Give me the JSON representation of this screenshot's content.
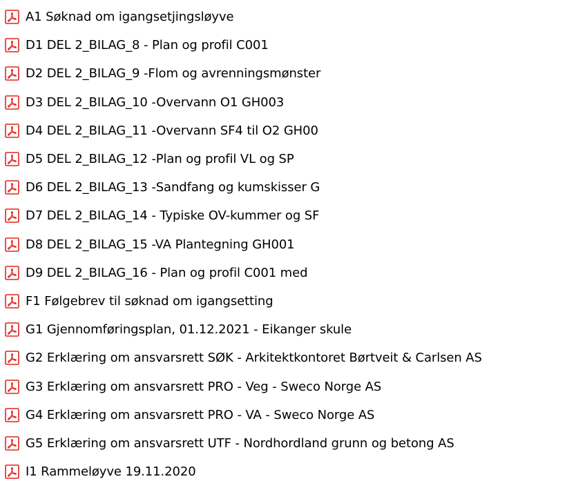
{
  "file_list": {
    "icon": "pdf-icon",
    "icon_color": "#e0241b",
    "items": [
      {
        "name": "A1 Søknad om igangsetjingsløyve"
      },
      {
        "name": "D1 DEL 2_BILAG_8 - Plan og profil C001"
      },
      {
        "name": "D2 DEL 2_BILAG_9 -Flom og avrenningsmønster"
      },
      {
        "name": "D3 DEL 2_BILAG_10 -Overvann O1 GH003"
      },
      {
        "name": "D4 DEL 2_BILAG_11 -Overvann SF4 til O2 GH00"
      },
      {
        "name": "D5 DEL 2_BILAG_12 -Plan og profil VL og SP"
      },
      {
        "name": "D6 DEL 2_BILAG_13 -Sandfang og kumskisser G"
      },
      {
        "name": "D7 DEL 2_BILAG_14 - Typiske OV-kummer og SF"
      },
      {
        "name": "D8 DEL 2_BILAG_15 -VA Plantegning GH001"
      },
      {
        "name": "D9 DEL 2_BILAG_16 - Plan og profil C001 med"
      },
      {
        "name": "F1 Følgebrev til søknad om igangsetting"
      },
      {
        "name": "G1 Gjennomføringsplan, 01.12.2021 - Eikanger skule"
      },
      {
        "name": "G2 Erklæring om ansvarsrett SØK - Arkitektkontoret Børtveit & Carlsen AS"
      },
      {
        "name": "G3 Erklæring om ansvarsrett PRO - Veg - Sweco Norge AS"
      },
      {
        "name": "G4 Erklæring om ansvarsrett PRO - VA - Sweco Norge AS"
      },
      {
        "name": "G5 Erklæring om ansvarsrett UTF - Nordhordland grunn og betong AS"
      },
      {
        "name": "I1 Rammeløyve 19.11.2020"
      }
    ]
  }
}
